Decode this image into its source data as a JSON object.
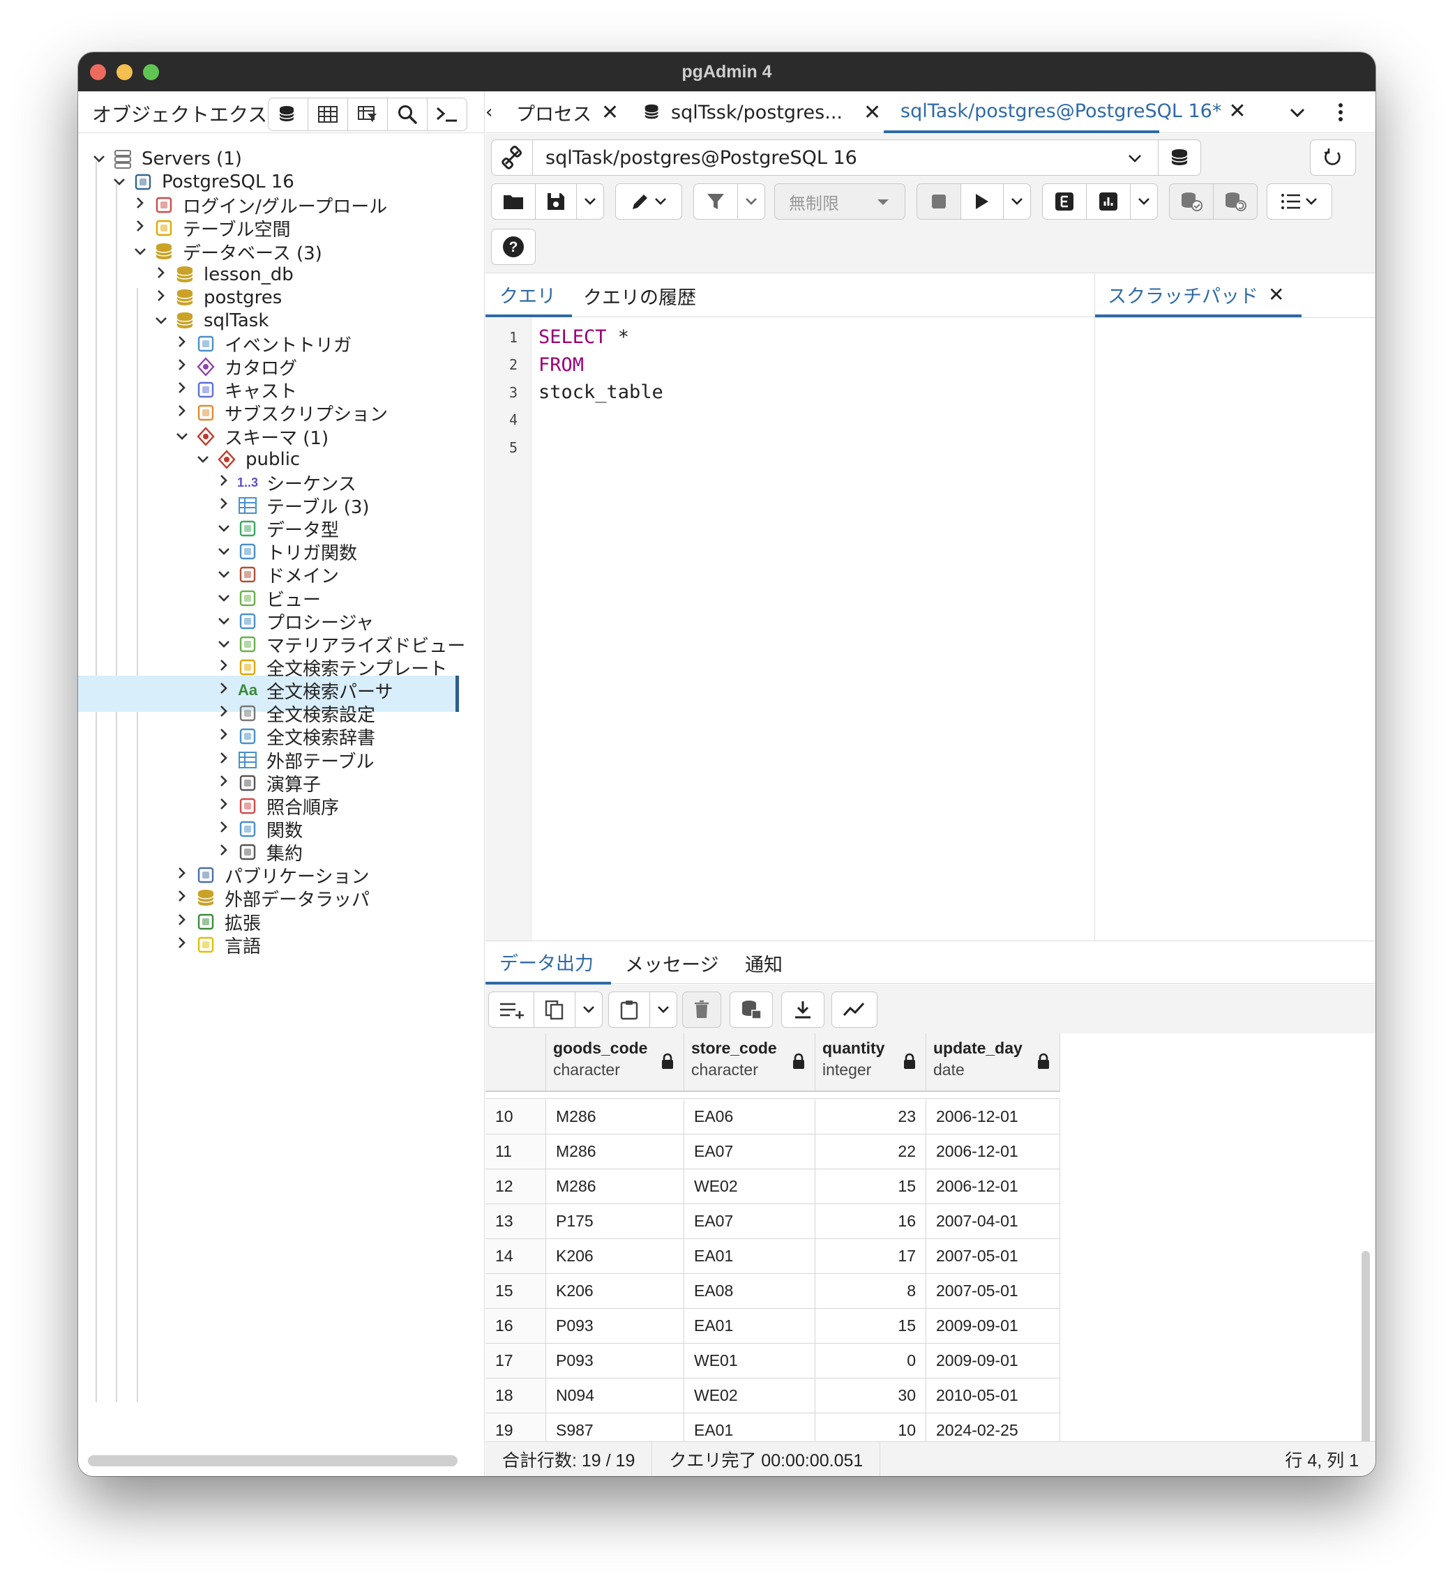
{
  "window": {
    "title": "pgAdmin 4"
  },
  "left_panel": {
    "title": "オブジェクトエクスプローラ",
    "tree": [
      {
        "label": "Servers (1)",
        "expanded": true,
        "icon": "servers-icon"
      },
      {
        "label": "PostgreSQL 16",
        "expanded": true,
        "icon": "postgresql-elephant-icon"
      },
      {
        "label": "ログイン/グループロール",
        "expanded": false,
        "icon": "roles-icon"
      },
      {
        "label": "テーブル空間",
        "expanded": false,
        "icon": "tablespace-icon"
      },
      {
        "label": "データベース (3)",
        "expanded": true,
        "icon": "databases-icon"
      },
      {
        "label": "lesson_db",
        "expanded": false,
        "icon": "database-icon"
      },
      {
        "label": "postgres",
        "expanded": false,
        "icon": "database-icon"
      },
      {
        "label": "sqlTask",
        "expanded": true,
        "icon": "database-icon"
      },
      {
        "label": "イベントトリガ",
        "expanded": false,
        "icon": "event-trigger-icon"
      },
      {
        "label": "カタログ",
        "expanded": false,
        "icon": "catalog-icon"
      },
      {
        "label": "キャスト",
        "expanded": false,
        "icon": "cast-icon"
      },
      {
        "label": "サブスクリプション",
        "expanded": false,
        "icon": "subscription-icon"
      },
      {
        "label": "スキーマ (1)",
        "expanded": true,
        "icon": "schemas-icon"
      },
      {
        "label": "public",
        "expanded": true,
        "icon": "schema-icon"
      },
      {
        "label": "シーケンス",
        "expanded": false,
        "icon": "sequence-icon"
      },
      {
        "label": "テーブル (3)",
        "expanded": false,
        "icon": "table-icon"
      },
      {
        "label": "データ型",
        "expanded": true,
        "icon": "datatype-icon"
      },
      {
        "label": "トリガ関数",
        "expanded": true,
        "icon": "trigger-function-icon"
      },
      {
        "label": "ドメイン",
        "expanded": true,
        "icon": "domain-icon"
      },
      {
        "label": "ビュー",
        "expanded": true,
        "icon": "view-icon"
      },
      {
        "label": "プロシージャ",
        "expanded": true,
        "icon": "procedure-icon"
      },
      {
        "label": "マテリアライズドビュー",
        "expanded": true,
        "icon": "materialized-view-icon"
      },
      {
        "label": "全文検索テンプレート",
        "expanded": false,
        "icon": "fts-template-icon"
      },
      {
        "label": "全文検索パーサ",
        "expanded": false,
        "icon": "fts-parser-icon"
      },
      {
        "label": "全文検索設定",
        "expanded": false,
        "icon": "fts-config-icon"
      },
      {
        "label": "全文検索辞書",
        "expanded": false,
        "icon": "fts-dictionary-icon"
      },
      {
        "label": "外部テーブル",
        "expanded": false,
        "icon": "foreign-table-icon"
      },
      {
        "label": "演算子",
        "expanded": false,
        "icon": "operator-icon"
      },
      {
        "label": "照合順序",
        "expanded": false,
        "icon": "collation-icon"
      },
      {
        "label": "関数",
        "expanded": false,
        "icon": "function-icon"
      },
      {
        "label": "集約",
        "expanded": false,
        "icon": "aggregate-icon"
      },
      {
        "label": "パブリケーション",
        "expanded": false,
        "icon": "publication-icon"
      },
      {
        "label": "外部データラッパ",
        "expanded": false,
        "icon": "foreign-data-wrapper-icon"
      },
      {
        "label": "拡張",
        "expanded": false,
        "icon": "extension-icon"
      },
      {
        "label": "言語",
        "expanded": false,
        "icon": "language-icon"
      }
    ],
    "sequence_badge": "1..3",
    "parser_badge": "Aa"
  },
  "tabs": [
    {
      "label": "プロセス",
      "active": false
    },
    {
      "label": "sqlTssk/postgres...",
      "active": false
    },
    {
      "label": "sqlTask/postgres@PostgreSQL 16*",
      "active": true
    }
  ],
  "connection": {
    "value": "sqlTask/postgres@PostgreSQL 16"
  },
  "toolbar": {
    "limit_label": "無制限"
  },
  "query_tabs": {
    "query": "クエリ",
    "history": "クエリの履歴",
    "scratchpad": "スクラッチパッド"
  },
  "editor": {
    "line_numbers": [
      "1",
      "2",
      "3",
      "4",
      "5"
    ],
    "kw_select": "SELECT",
    "select_rest": " *",
    "kw_from": "FROM",
    "line3": "stock_table"
  },
  "output_tabs": {
    "data": "データ出力",
    "messages": "メッセージ",
    "notify": "通知"
  },
  "columns": [
    {
      "name": "goods_code",
      "type": "character"
    },
    {
      "name": "store_code",
      "type": "character"
    },
    {
      "name": "quantity",
      "type": "integer"
    },
    {
      "name": "update_day",
      "type": "date"
    }
  ],
  "rows": [
    [
      "10",
      "M286",
      "EA06",
      "23",
      "2006-12-01"
    ],
    [
      "11",
      "M286",
      "EA07",
      "22",
      "2006-12-01"
    ],
    [
      "12",
      "M286",
      "WE02",
      "15",
      "2006-12-01"
    ],
    [
      "13",
      "P175",
      "EA07",
      "16",
      "2007-04-01"
    ],
    [
      "14",
      "K206",
      "EA01",
      "17",
      "2007-05-01"
    ],
    [
      "15",
      "K206",
      "EA08",
      "8",
      "2007-05-01"
    ],
    [
      "16",
      "P093",
      "EA01",
      "15",
      "2009-09-01"
    ],
    [
      "17",
      "P093",
      "WE01",
      "0",
      "2009-09-01"
    ],
    [
      "18",
      "N094",
      "WE02",
      "30",
      "2010-05-01"
    ],
    [
      "19",
      "S987",
      "EA01",
      "10",
      "2024-02-25"
    ]
  ],
  "status": {
    "total_rows": "合計行数: 19 / 19",
    "query_done": "クエリ完了 00:00:00.051",
    "position": "行 4, 列 1"
  },
  "colors": {
    "accent": "#2e6aa6",
    "keyword": "#990077",
    "selected_row": "#d9eefb",
    "traffic_red": "#ed6a5e",
    "traffic_yellow": "#f5bf4f",
    "traffic_green": "#61c554"
  }
}
